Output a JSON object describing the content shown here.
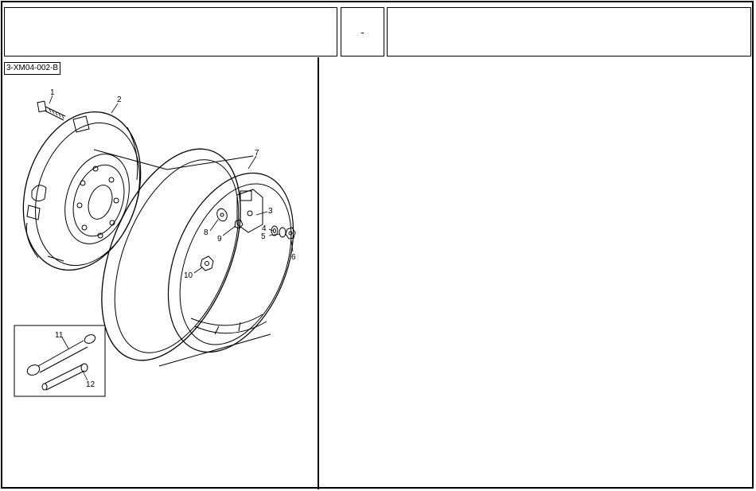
{
  "header": {
    "left_text": "",
    "middle_text": "-",
    "right_text": ""
  },
  "figure": {
    "reference_code": "3-XM04-002-B",
    "callouts": [
      "1",
      "2",
      "3",
      "4",
      "5",
      "6",
      "7",
      "8",
      "9",
      "10",
      "11",
      "12"
    ]
  }
}
